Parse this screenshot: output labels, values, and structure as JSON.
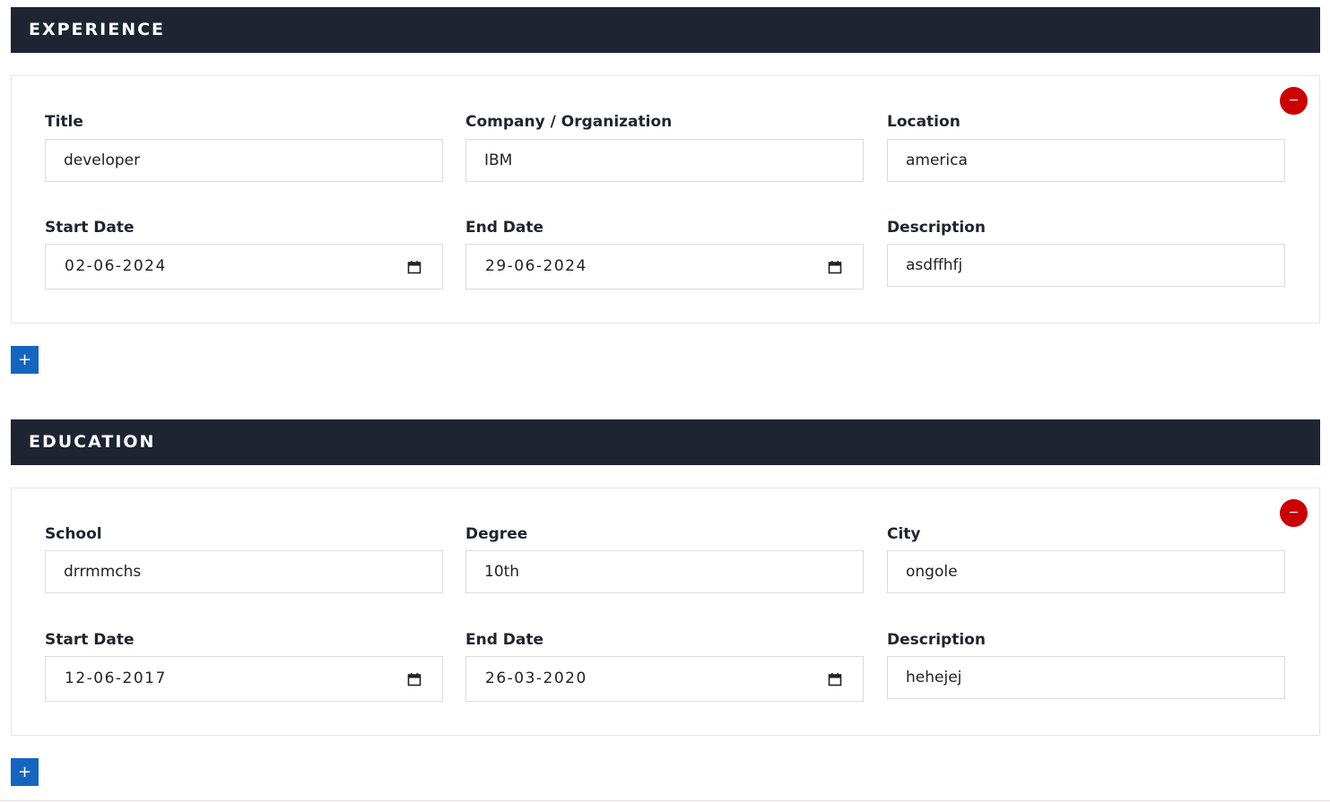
{
  "experience": {
    "heading": "EXPERIENCE",
    "remove_label": "−",
    "add_label": "+",
    "fields": {
      "title": {
        "label": "Title",
        "value": "developer"
      },
      "company": {
        "label": "Company / Organization",
        "value": "IBM"
      },
      "location": {
        "label": "Location",
        "value": "america"
      },
      "start_date": {
        "label": "Start Date",
        "value": "02-06-2024"
      },
      "end_date": {
        "label": "End Date",
        "value": "29-06-2024"
      },
      "description": {
        "label": "Description",
        "value": "asdffhfj"
      }
    }
  },
  "education": {
    "heading": "EDUCATION",
    "remove_label": "−",
    "add_label": "+",
    "fields": {
      "school": {
        "label": "School",
        "value": "drrmmchs"
      },
      "degree": {
        "label": "Degree",
        "value": "10th"
      },
      "city": {
        "label": "City",
        "value": "ongole"
      },
      "start_date": {
        "label": "Start Date",
        "value": "12-06-2017"
      },
      "end_date": {
        "label": "End Date",
        "value": "26-03-2020"
      },
      "description": {
        "label": "Description",
        "value": "hehejej"
      }
    }
  },
  "colors": {
    "header_bg": "#1e2432",
    "remove_button": "#cc0000",
    "add_button": "#1565c0"
  },
  "icons": {
    "calendar": "calendar-icon",
    "remove": "minus-icon",
    "add": "plus-icon"
  }
}
